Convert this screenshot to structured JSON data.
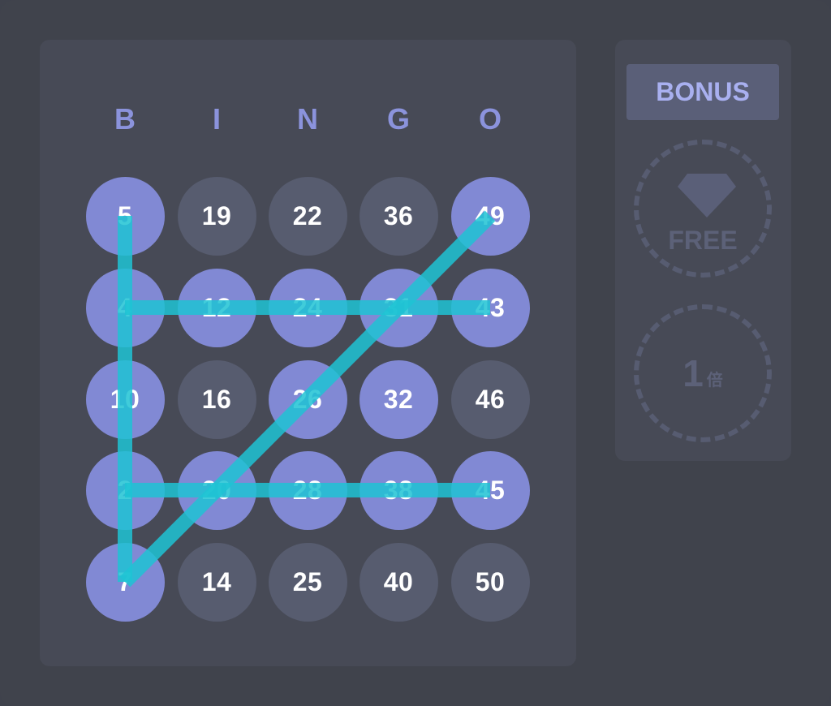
{
  "header": [
    "B",
    "I",
    "N",
    "G",
    "O"
  ],
  "grid": [
    [
      {
        "n": "5",
        "marked": true
      },
      {
        "n": "19",
        "marked": false
      },
      {
        "n": "22",
        "marked": false
      },
      {
        "n": "36",
        "marked": false
      },
      {
        "n": "49",
        "marked": true
      }
    ],
    [
      {
        "n": "4",
        "marked": true
      },
      {
        "n": "12",
        "marked": true
      },
      {
        "n": "24",
        "marked": true
      },
      {
        "n": "31",
        "marked": true
      },
      {
        "n": "43",
        "marked": true
      }
    ],
    [
      {
        "n": "10",
        "marked": true
      },
      {
        "n": "16",
        "marked": false
      },
      {
        "n": "26",
        "marked": true
      },
      {
        "n": "32",
        "marked": true
      },
      {
        "n": "46",
        "marked": false
      }
    ],
    [
      {
        "n": "2",
        "marked": true
      },
      {
        "n": "20",
        "marked": true
      },
      {
        "n": "28",
        "marked": true
      },
      {
        "n": "38",
        "marked": true
      },
      {
        "n": "45",
        "marked": true
      }
    ],
    [
      {
        "n": "7",
        "marked": true
      },
      {
        "n": "14",
        "marked": false
      },
      {
        "n": "25",
        "marked": false
      },
      {
        "n": "40",
        "marked": false
      },
      {
        "n": "50",
        "marked": false
      }
    ]
  ],
  "win_lines": [
    {
      "from": [
        0,
        0
      ],
      "to": [
        4,
        0
      ]
    },
    {
      "from": [
        1,
        0
      ],
      "to": [
        1,
        4
      ]
    },
    {
      "from": [
        3,
        0
      ],
      "to": [
        3,
        4
      ]
    },
    {
      "from": [
        4,
        0
      ],
      "to": [
        0,
        4
      ]
    }
  ],
  "sidebar": {
    "bonus_label": "BONUS",
    "free_label": "FREE",
    "free_icon": "diamond-icon",
    "multiplier": "1",
    "multiplier_unit": "倍"
  },
  "colors": {
    "marked": "#8189d4",
    "unmarked": "#575c6f",
    "line": "#1fc3d4",
    "header": "#8b93dc"
  }
}
